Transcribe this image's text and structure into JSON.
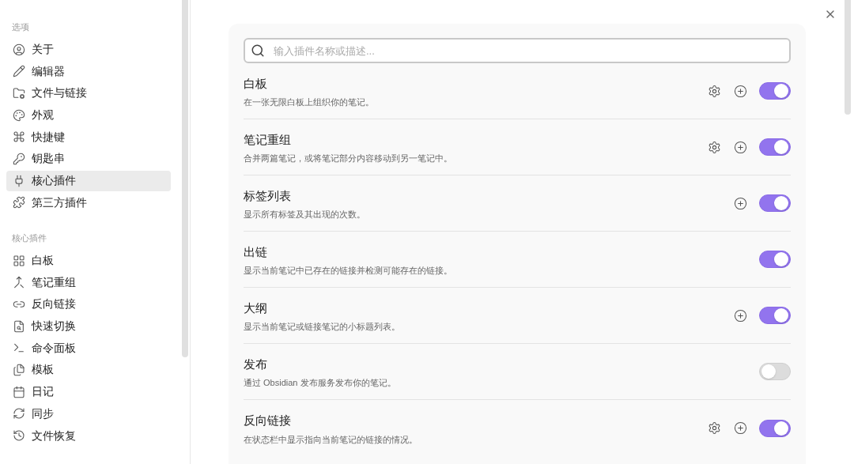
{
  "sidebar": {
    "sections": [
      {
        "heading": "选项",
        "items": [
          {
            "label": "关于",
            "selected": false
          },
          {
            "label": "编辑器",
            "selected": false
          },
          {
            "label": "文件与链接",
            "selected": false
          },
          {
            "label": "外观",
            "selected": false
          },
          {
            "label": "快捷键",
            "selected": false
          },
          {
            "label": "钥匙串",
            "selected": false
          },
          {
            "label": "核心插件",
            "selected": true
          },
          {
            "label": "第三方插件",
            "selected": false
          }
        ]
      },
      {
        "heading": "核心插件",
        "items": [
          {
            "label": "白板",
            "selected": false
          },
          {
            "label": "笔记重组",
            "selected": false
          },
          {
            "label": "反向链接",
            "selected": false
          },
          {
            "label": "快速切换",
            "selected": false
          },
          {
            "label": "命令面板",
            "selected": false
          },
          {
            "label": "模板",
            "selected": false
          },
          {
            "label": "日记",
            "selected": false
          },
          {
            "label": "同步",
            "selected": false
          },
          {
            "label": "文件恢复",
            "selected": false
          }
        ]
      }
    ]
  },
  "search": {
    "placeholder": "输入插件名称或描述..."
  },
  "plugins": [
    {
      "name": "白板",
      "description": "在一张无限白板上组织你的笔记。",
      "has_settings": true,
      "has_hotkey": true,
      "on": true
    },
    {
      "name": "笔记重组",
      "description": "合并两篇笔记，或将笔记部分内容移动到另一笔记中。",
      "has_settings": true,
      "has_hotkey": true,
      "on": true
    },
    {
      "name": "标签列表",
      "description": "显示所有标签及其出现的次数。",
      "has_settings": false,
      "has_hotkey": true,
      "on": true
    },
    {
      "name": "出链",
      "description": "显示当前笔记中已存在的链接并检测可能存在的链接。",
      "has_settings": false,
      "has_hotkey": false,
      "on": true
    },
    {
      "name": "大纲",
      "description": "显示当前笔记或链接笔记的小标题列表。",
      "has_settings": false,
      "has_hotkey": true,
      "on": true
    },
    {
      "name": "发布",
      "description": "通过 Obsidian 发布服务发布你的笔记。",
      "has_settings": false,
      "has_hotkey": false,
      "on": false
    },
    {
      "name": "反向链接",
      "description": "在状态栏中显示指向当前笔记的链接的情况。",
      "has_settings": true,
      "has_hotkey": true,
      "on": true
    }
  ]
}
